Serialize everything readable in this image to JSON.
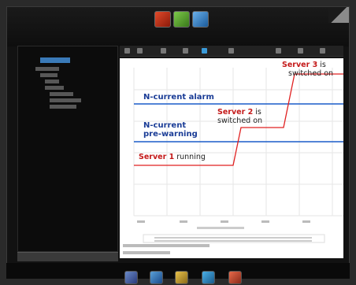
{
  "annotations": {
    "alarm_label": "N-current alarm",
    "prewarning_line1": "N-current",
    "prewarning_line2": "pre-warning",
    "server1_name": "Server 1",
    "server1_state": " running",
    "server2_name": "Server 2",
    "server2_suffix": " is",
    "server2_line2": "switched on",
    "server3_name": "Server 3",
    "server3_suffix": " is",
    "server3_line2": "switched on"
  },
  "colors": {
    "annotation_red": "#c41a1a",
    "annotation_blue": "#1a3c96",
    "threshold_line": "#1a5cc8",
    "current_trace": "#e02020"
  },
  "toolbar_icons": [
    "measure-app-icon",
    "power-app-icon",
    "config-app-icon"
  ],
  "dock_icons": [
    "dock-app-1-icon",
    "dock-app-2-icon",
    "dock-app-3-icon",
    "dock-app-4-icon",
    "dock-app-5-icon"
  ]
}
